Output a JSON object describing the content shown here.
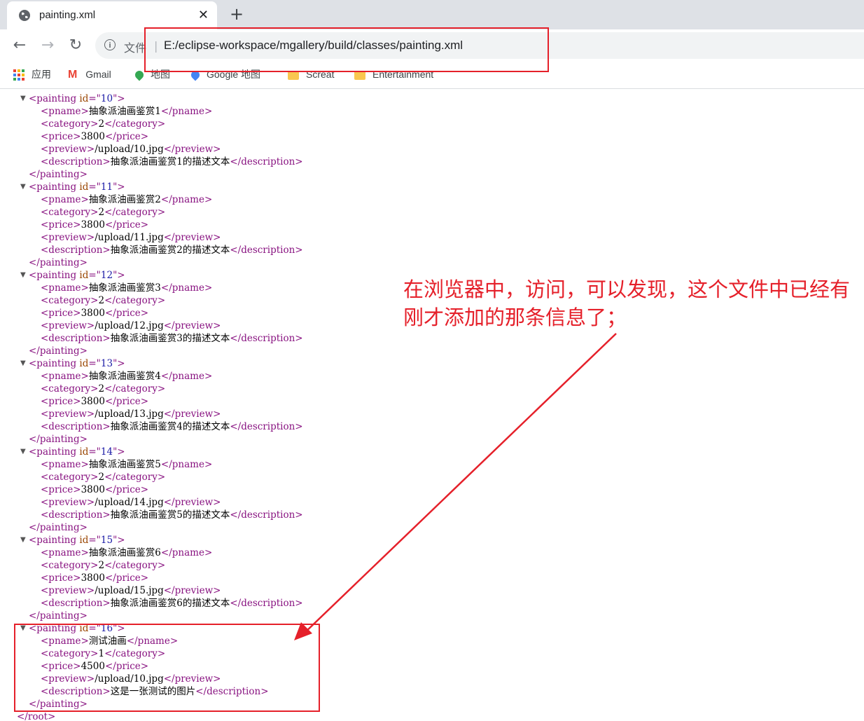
{
  "tab": {
    "title": "painting.xml",
    "close": "✕"
  },
  "toolbar": {
    "new_tab": "+",
    "back": "←",
    "forward": "→",
    "reload": "↻"
  },
  "omnibox": {
    "scheme": "文件",
    "separator": "|",
    "url": "E:/eclipse-workspace/mgallery/build/classes/painting.xml"
  },
  "bookmarks": [
    {
      "label": "应用"
    },
    {
      "label": "Gmail"
    },
    {
      "label": "地图"
    },
    {
      "label": "Google 地图"
    },
    {
      "label": "Screat"
    },
    {
      "label": "Entertainment"
    }
  ],
  "paintings": [
    {
      "id": "10",
      "pname": "抽象派油画鉴赏1",
      "category": "2",
      "price": "3800",
      "preview": "/upload/10.jpg",
      "description": "抽象派油画鉴赏1的描述文本"
    },
    {
      "id": "11",
      "pname": "抽象派油画鉴赏2",
      "category": "2",
      "price": "3800",
      "preview": "/upload/11.jpg",
      "description": "抽象派油画鉴赏2的描述文本"
    },
    {
      "id": "12",
      "pname": "抽象派油画鉴赏3",
      "category": "2",
      "price": "3800",
      "preview": "/upload/12.jpg",
      "description": "抽象派油画鉴赏3的描述文本"
    },
    {
      "id": "13",
      "pname": "抽象派油画鉴赏4",
      "category": "2",
      "price": "3800",
      "preview": "/upload/13.jpg",
      "description": "抽象派油画鉴赏4的描述文本"
    },
    {
      "id": "14",
      "pname": "抽象派油画鉴赏5",
      "category": "2",
      "price": "3800",
      "preview": "/upload/14.jpg",
      "description": "抽象派油画鉴赏5的描述文本"
    },
    {
      "id": "15",
      "pname": "抽象派油画鉴赏6",
      "category": "2",
      "price": "3800",
      "preview": "/upload/15.jpg",
      "description": "抽象派油画鉴赏6的描述文本"
    },
    {
      "id": "16",
      "pname": "测试油画",
      "category": "1",
      "price": "4500",
      "preview": "/upload/10.jpg",
      "description": "这是一张测试的图片"
    }
  ],
  "root_close": "</root>",
  "annotation": {
    "text": "在浏览器中，访问，可以发现，这个文件中已经有刚才添加的那条信息了；",
    "color": "#e5202a"
  },
  "colors": {
    "tag": "#881280",
    "attr_name": "#994500",
    "attr_value": "#1a1aa6"
  }
}
